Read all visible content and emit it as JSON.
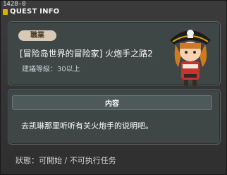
{
  "window": {
    "quest_id": "1428-0",
    "title": "QUEST INFO"
  },
  "quest": {
    "category_badge": "職業",
    "name": "[冒险岛世界的冒险家] 火炮手之路2",
    "recommended_level": "建議等級：30以上"
  },
  "content": {
    "section_title": "内容",
    "description": "去凯琳那里听听有关火炮手的说明吧。"
  },
  "footer": {
    "status": "狀態：可開始 / 不可执行任务"
  },
  "colors": {
    "panel_bg": "#3f4646",
    "badge_bg": "#d8c8b6",
    "window_bg": "#333333",
    "title_accent": "#e0b000"
  },
  "icons": {
    "portrait": "pirate-cannoneer-portrait"
  }
}
